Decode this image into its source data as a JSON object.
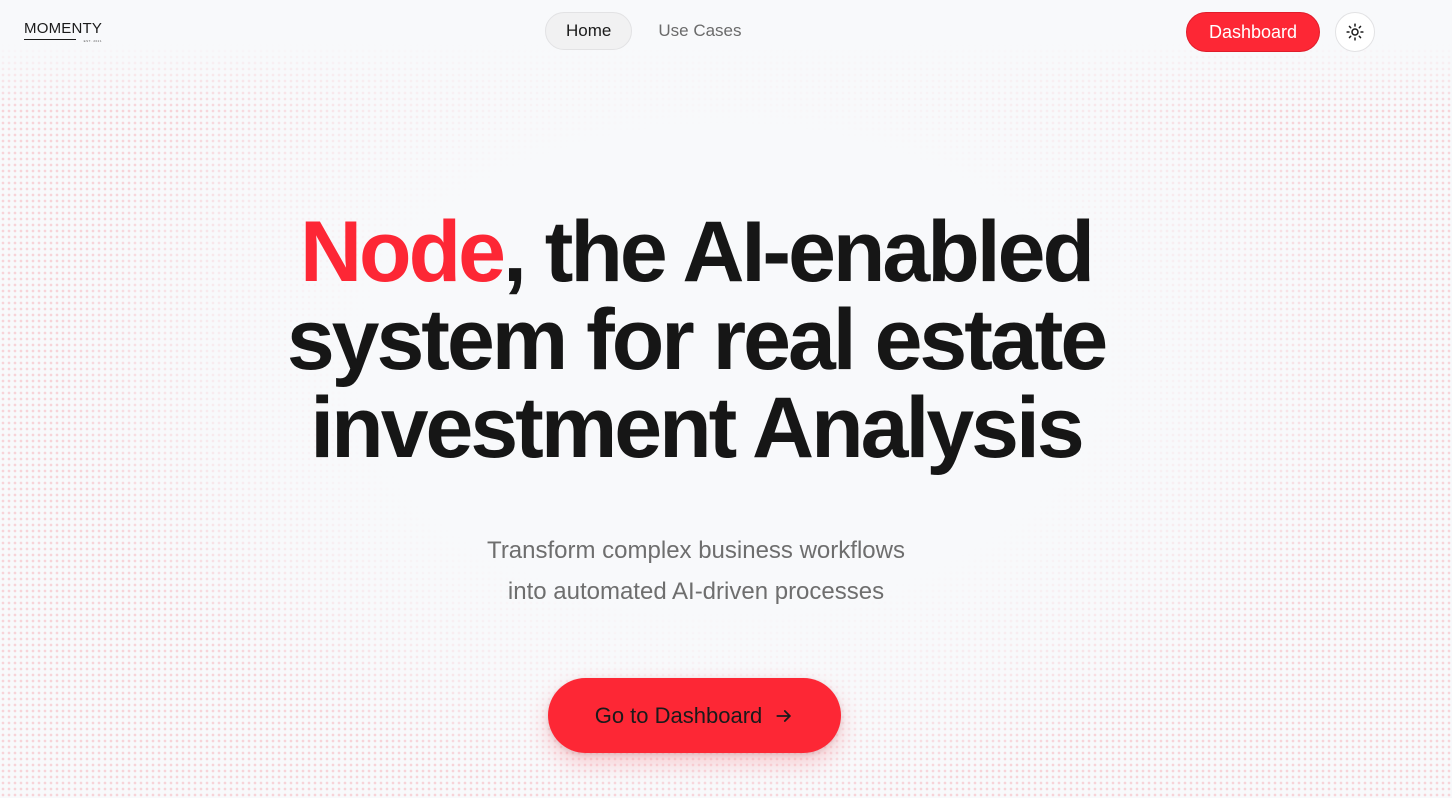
{
  "header": {
    "logo_text": "MOMENTY",
    "logo_subtext": "EST. 2021",
    "nav": [
      {
        "label": "Home",
        "active": true
      },
      {
        "label": "Use Cases",
        "active": false
      }
    ],
    "dashboard_label": "Dashboard",
    "theme_toggle_icon": "sun-icon"
  },
  "hero": {
    "title_accent": "Node",
    "title_rest_line1": ", the AI-enabled",
    "title_line2": "system for real estate",
    "title_line3": "investment Analysis",
    "subtitle_line1": "Transform complex business workflows",
    "subtitle_line2": "into automated AI-driven processes",
    "cta_label": "Go to Dashboard",
    "cta_icon": "arrow-right-icon"
  },
  "colors": {
    "accent": "#fd2735",
    "text": "#161616",
    "muted": "#6e6e6e",
    "background": "#f8f9fb"
  }
}
